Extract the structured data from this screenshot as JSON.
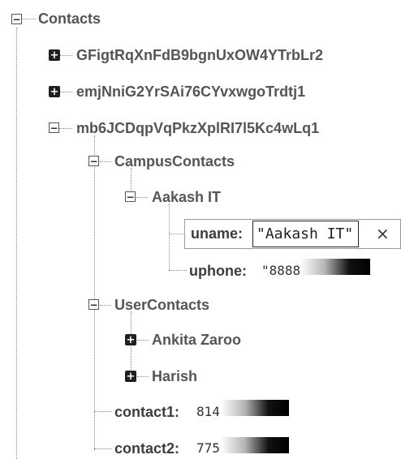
{
  "tree": {
    "root": {
      "label": "Contacts",
      "toggle": "−"
    },
    "nodes": [
      {
        "label": "GFigtRqXnFdB9bgnUxOW4YTrbLr2",
        "toggle": "+"
      },
      {
        "label": "emjNniG2YrSAi76CYvxwgoTrdtj1",
        "toggle": "+"
      },
      {
        "label": "mb6JCDqpVqPkzXplRI7l5Kc4wLq1",
        "toggle": "−"
      }
    ],
    "campus": {
      "label": "CampusContacts",
      "toggle": "−",
      "child": {
        "label": "Aakash IT",
        "toggle": "−",
        "uname_key": "uname:",
        "uname_value": "\"Aakash IT\"",
        "clear_icon": "×",
        "uphone_key": "uphone:",
        "uphone_value": "\"8888"
      }
    },
    "user": {
      "label": "UserContacts",
      "toggle": "−",
      "children": [
        {
          "label": "Ankita Zaroo",
          "toggle": "+"
        },
        {
          "label": "Harish",
          "toggle": "+"
        }
      ]
    },
    "contact1_key": "contact1:",
    "contact1_value": "8149",
    "contact2_key": "contact2:",
    "contact2_value": "7756"
  }
}
